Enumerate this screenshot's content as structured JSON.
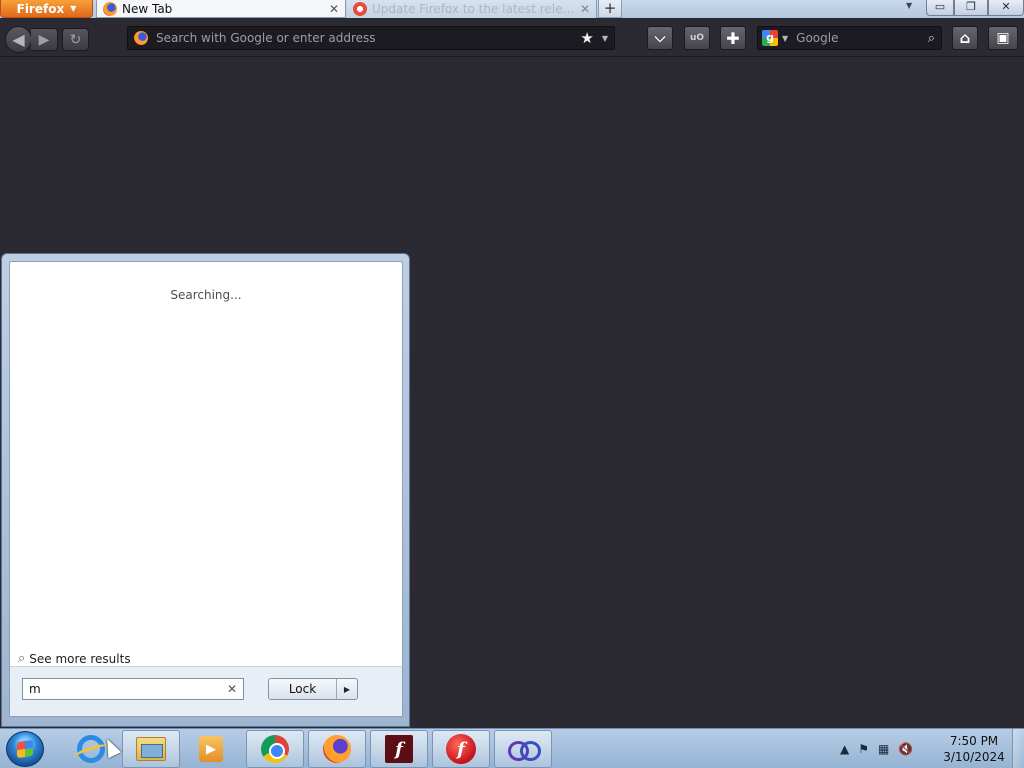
{
  "browser": {
    "app_button": "Firefox",
    "tabs": [
      {
        "label": "New Tab",
        "active": true
      },
      {
        "label": "Update Firefox to the latest release | Fi...",
        "active": false
      }
    ],
    "new_tab_symbol": "+",
    "urlbar_placeholder": "Search with Google or enter address",
    "search_engine_placeholder": "Google",
    "window_controls": {
      "minimize": "▭",
      "restore": "❐",
      "close": "✕"
    },
    "toolbar_icons": [
      "pocket-icon",
      "ublock-icon",
      "addons-icon",
      "home-icon",
      "extra-icon"
    ],
    "content_background": "#2b2a33"
  },
  "start_menu": {
    "status_text": "Searching...",
    "see_more_label": "See more results",
    "search_value": "m",
    "power_button_label": "Lock"
  },
  "taskbar": {
    "pinned": [
      "internet-explorer",
      "windows-explorer",
      "media-player",
      "chrome",
      "firefox",
      "flash-professional",
      "flash-player",
      "infinity-app"
    ],
    "clock_time": "7:50 PM",
    "clock_date": "3/10/2024"
  },
  "colors": {
    "firefox_orange": "#e2681a",
    "taskbar_blue": "#a7c1dd",
    "dark_theme": "#2b2a33"
  }
}
